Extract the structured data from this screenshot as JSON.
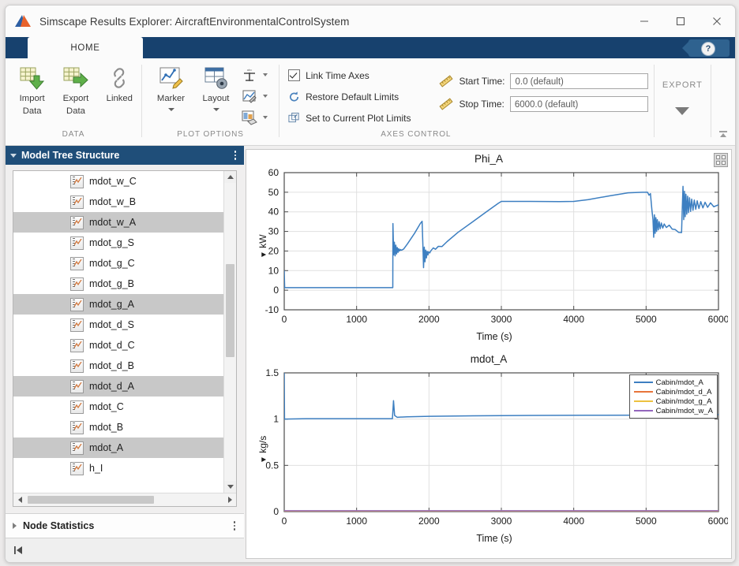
{
  "window": {
    "title": "Simscape Results Explorer: AircraftEnvironmentalControlSystem",
    "logo_icon": "matlab-logo-icon",
    "minimize_label": "–",
    "maximize_label": "□",
    "close_label": "✕"
  },
  "ribbon": {
    "tabs": [
      {
        "label": "HOME",
        "active": true
      }
    ],
    "help_label": "?",
    "groups": {
      "data": {
        "label": "DATA",
        "buttons": [
          {
            "label_line1": "Import",
            "label_line2": "Data",
            "icon": "import-data-icon"
          },
          {
            "label_line1": "Export",
            "label_line2": "Data",
            "icon": "export-data-icon"
          },
          {
            "label_line1": "Linked",
            "label_line2": "",
            "icon": "link-icon"
          }
        ]
      },
      "plot_options": {
        "label": "PLOT OPTIONS",
        "buttons": [
          {
            "label_line1": "Marker",
            "label_line2": "",
            "icon": "marker-icon"
          },
          {
            "label_line1": "Layout",
            "label_line2": "",
            "icon": "layout-icon"
          }
        ],
        "small_buttons": [
          {
            "icon": "axes-limits-icon"
          },
          {
            "icon": "plot-area-icon"
          },
          {
            "icon": "plot-style-icon"
          }
        ]
      },
      "axes_control": {
        "label": "AXES CONTROL",
        "checkbox": {
          "label": "Link Time Axes",
          "checked": true
        },
        "actions": [
          {
            "label": "Restore Default Limits",
            "icon": "restore-icon"
          },
          {
            "label": "Set to Current Plot Limits",
            "icon": "set-limits-icon"
          }
        ],
        "fields": [
          {
            "label": "Start Time:",
            "value": "0.0 (default)",
            "icon": "ruler-icon"
          },
          {
            "label": "Stop Time:",
            "value": "6000.0 (default)",
            "icon": "ruler-icon"
          }
        ]
      },
      "export": {
        "label": "EXPORT"
      }
    }
  },
  "sidebar": {
    "tree_panel": {
      "title": "Model Tree Structure",
      "items": [
        {
          "label": "h_I",
          "selected": false
        },
        {
          "label": "mdot_A",
          "selected": true
        },
        {
          "label": "mdot_B",
          "selected": false
        },
        {
          "label": "mdot_C",
          "selected": false
        },
        {
          "label": "mdot_d_A",
          "selected": true
        },
        {
          "label": "mdot_d_B",
          "selected": false
        },
        {
          "label": "mdot_d_C",
          "selected": false
        },
        {
          "label": "mdot_d_S",
          "selected": false
        },
        {
          "label": "mdot_g_A",
          "selected": true
        },
        {
          "label": "mdot_g_B",
          "selected": false
        },
        {
          "label": "mdot_g_C",
          "selected": false
        },
        {
          "label": "mdot_g_S",
          "selected": false
        },
        {
          "label": "mdot_w_A",
          "selected": true
        },
        {
          "label": "mdot_w_B",
          "selected": false
        },
        {
          "label": "mdot_w_C",
          "selected": false
        }
      ]
    },
    "stats_panel": {
      "title": "Node Statistics"
    },
    "status_bar": {
      "icon": "go-to-start-icon"
    }
  },
  "colors": {
    "title_blue": "#17416e",
    "panel_blue": "#1f4e79",
    "series_1": "#3d7fc1",
    "series_2": "#e8743b",
    "series_3": "#edc240",
    "series_4": "#9467bd",
    "selection_gray": "#c8c8c8"
  },
  "chart_data": [
    {
      "type": "line",
      "title": "Phi_A",
      "xlabel": "Time (s)",
      "ylabel": "kW",
      "xlim": [
        0,
        6000
      ],
      "ylim": [
        -10,
        60
      ],
      "xticks": [
        0,
        1000,
        2000,
        3000,
        4000,
        5000,
        6000
      ],
      "yticks": [
        -10,
        0,
        10,
        20,
        30,
        40,
        50,
        60
      ],
      "grid": true,
      "legend": null,
      "series": [
        {
          "name": "Phi_A",
          "color": "#3d7fc1",
          "points": [
            [
              0,
              10.0
            ],
            [
              6,
              1.3
            ],
            [
              1500,
              1.3
            ],
            [
              1502,
              34.0
            ],
            [
              1512,
              18.0
            ],
            [
              1522,
              24.5
            ],
            [
              1532,
              17.5
            ],
            [
              1542,
              23.0
            ],
            [
              1552,
              18.5
            ],
            [
              1562,
              21.8
            ],
            [
              1572,
              19.3
            ],
            [
              1582,
              21.2
            ],
            [
              1592,
              20.0
            ],
            [
              1605,
              20.8
            ],
            [
              1620,
              20.4
            ],
            [
              1650,
              21.0
            ],
            [
              1700,
              23.5
            ],
            [
              1800,
              29.0
            ],
            [
              1880,
              34.0
            ],
            [
              1905,
              35.2
            ],
            [
              1915,
              24.0
            ],
            [
              1925,
              11.5
            ],
            [
              1935,
              22.0
            ],
            [
              1945,
              14.5
            ],
            [
              1955,
              20.5
            ],
            [
              1965,
              16.5
            ],
            [
              1975,
              19.8
            ],
            [
              1985,
              18.0
            ],
            [
              1995,
              19.6
            ],
            [
              2010,
              19.0
            ],
            [
              2030,
              20.3
            ],
            [
              2060,
              21.6
            ],
            [
              2090,
              20.9
            ],
            [
              2130,
              22.4
            ],
            [
              2180,
              22.3
            ],
            [
              2250,
              24.8
            ],
            [
              2400,
              29.5
            ],
            [
              2600,
              34.8
            ],
            [
              2800,
              40.2
            ],
            [
              2960,
              44.4
            ],
            [
              3000,
              45.3
            ],
            [
              3400,
              45.3
            ],
            [
              3800,
              45.2
            ],
            [
              4000,
              45.3
            ],
            [
              4200,
              46.2
            ],
            [
              4500,
              48.2
            ],
            [
              4750,
              49.7
            ],
            [
              4950,
              50.0
            ],
            [
              5020,
              50.0
            ],
            [
              5040,
              48.5
            ],
            [
              5060,
              49.3
            ],
            [
              5080,
              41.0
            ],
            [
              5095,
              36.0
            ],
            [
              5105,
              27.0
            ],
            [
              5115,
              38.5
            ],
            [
              5125,
              29.0
            ],
            [
              5135,
              37.0
            ],
            [
              5145,
              30.0
            ],
            [
              5155,
              36.0
            ],
            [
              5168,
              30.8
            ],
            [
              5180,
              35.0
            ],
            [
              5195,
              31.4
            ],
            [
              5210,
              34.3
            ],
            [
              5230,
              31.7
            ],
            [
              5250,
              33.8
            ],
            [
              5280,
              32.0
            ],
            [
              5320,
              33.2
            ],
            [
              5360,
              31.2
            ],
            [
              5400,
              31.0
            ],
            [
              5450,
              29.5
            ],
            [
              5490,
              29.4
            ],
            [
              5500,
              42.0
            ],
            [
              5510,
              53.0
            ],
            [
              5520,
              36.0
            ],
            [
              5530,
              50.5
            ],
            [
              5540,
              37.5
            ],
            [
              5550,
              49.0
            ],
            [
              5562,
              38.8
            ],
            [
              5574,
              48.0
            ],
            [
              5586,
              39.6
            ],
            [
              5600,
              47.2
            ],
            [
              5615,
              40.2
            ],
            [
              5630,
              46.5
            ],
            [
              5648,
              40.8
            ],
            [
              5666,
              46.0
            ],
            [
              5686,
              41.3
            ],
            [
              5706,
              45.6
            ],
            [
              5730,
              41.7
            ],
            [
              5755,
              45.2
            ],
            [
              5785,
              42.0
            ],
            [
              5815,
              44.9
            ],
            [
              5850,
              42.3
            ],
            [
              5890,
              44.6
            ],
            [
              5935,
              42.6
            ],
            [
              6000,
              43.6
            ]
          ]
        }
      ]
    },
    {
      "type": "line",
      "title": "mdot_A",
      "xlabel": "Time (s)",
      "ylabel": "kg/s",
      "xlim": [
        0,
        6000
      ],
      "ylim": [
        0,
        1.5
      ],
      "xticks": [
        0,
        1000,
        2000,
        3000,
        4000,
        5000,
        6000
      ],
      "yticks": [
        0,
        0.5,
        1,
        1.5
      ],
      "grid": true,
      "legend": {
        "position": "top-right",
        "entries": [
          {
            "label": "Cabin/mdot_A",
            "color": "#3d7fc1"
          },
          {
            "label": "Cabin/mdot_d_A",
            "color": "#e8743b"
          },
          {
            "label": "Cabin/mdot_g_A",
            "color": "#edc240"
          },
          {
            "label": "Cabin/mdot_w_A",
            "color": "#9467bd"
          }
        ]
      },
      "series": [
        {
          "name": "Cabin/mdot_A",
          "color": "#3d7fc1",
          "points": [
            [
              0,
              1.5
            ],
            [
              4,
              1.0
            ],
            [
              300,
              1.005
            ],
            [
              900,
              1.005
            ],
            [
              1400,
              1.005
            ],
            [
              1495,
              1.005
            ],
            [
              1510,
              1.2
            ],
            [
              1525,
              1.04
            ],
            [
              1560,
              1.02
            ],
            [
              1700,
              1.025
            ],
            [
              2000,
              1.03
            ],
            [
              2600,
              1.035
            ],
            [
              3400,
              1.04
            ],
            [
              4200,
              1.042
            ],
            [
              5200,
              1.043
            ],
            [
              5950,
              1.043
            ],
            [
              6000,
              1.05
            ]
          ]
        },
        {
          "name": "Cabin/mdot_d_A",
          "color": "#e8743b",
          "points": [
            [
              0,
              0.004
            ],
            [
              6000,
              0.004
            ]
          ]
        },
        {
          "name": "Cabin/mdot_g_A",
          "color": "#edc240",
          "points": [
            [
              0,
              0.007
            ],
            [
              6000,
              0.007
            ]
          ]
        },
        {
          "name": "Cabin/mdot_w_A",
          "color": "#9467bd",
          "points": [
            [
              0,
              0.01
            ],
            [
              6000,
              0.01
            ]
          ]
        }
      ]
    }
  ]
}
